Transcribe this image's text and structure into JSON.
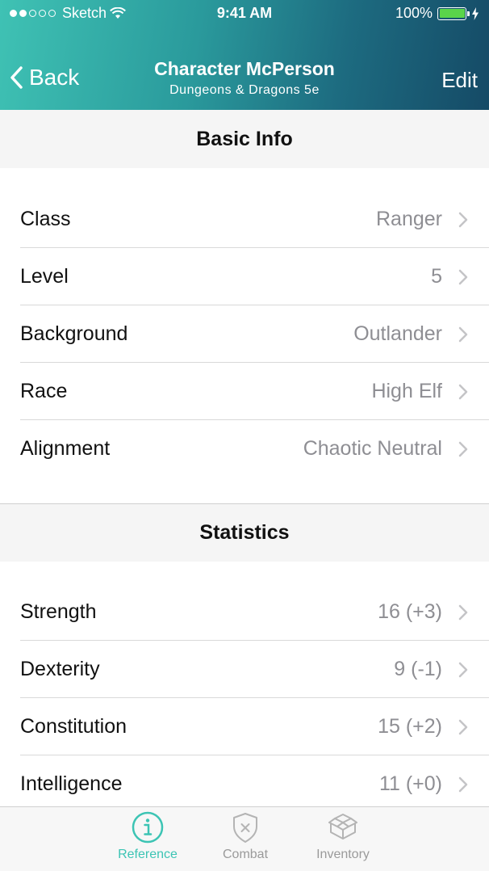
{
  "status_bar": {
    "carrier": "Sketch",
    "time": "9:41 AM",
    "battery": "100%"
  },
  "nav": {
    "back_label": "Back",
    "title": "Character McPerson",
    "subtitle": "Dungeons & Dragons 5e",
    "edit_label": "Edit"
  },
  "sections": {
    "basic_info": {
      "title": "Basic Info",
      "rows": [
        {
          "label": "Class",
          "value": "Ranger"
        },
        {
          "label": "Level",
          "value": "5"
        },
        {
          "label": "Background",
          "value": "Outlander"
        },
        {
          "label": "Race",
          "value": "High Elf"
        },
        {
          "label": "Alignment",
          "value": "Chaotic Neutral"
        }
      ]
    },
    "statistics": {
      "title": "Statistics",
      "rows": [
        {
          "label": "Strength",
          "value": "16 (+3)"
        },
        {
          "label": "Dexterity",
          "value": "9 (-1)"
        },
        {
          "label": "Constitution",
          "value": "15 (+2)"
        },
        {
          "label": "Intelligence",
          "value": "11 (+0)"
        }
      ]
    }
  },
  "tabbar": {
    "tabs": [
      {
        "label": "Reference",
        "icon": "info-icon",
        "active": true
      },
      {
        "label": "Combat",
        "icon": "shield-icon",
        "active": false
      },
      {
        "label": "Inventory",
        "icon": "boxes-icon",
        "active": false
      }
    ]
  },
  "colors": {
    "accent": "#3cc4b4",
    "header_start": "#3fc2b4",
    "header_end": "#154a66",
    "value_gray": "#8e8e93"
  }
}
